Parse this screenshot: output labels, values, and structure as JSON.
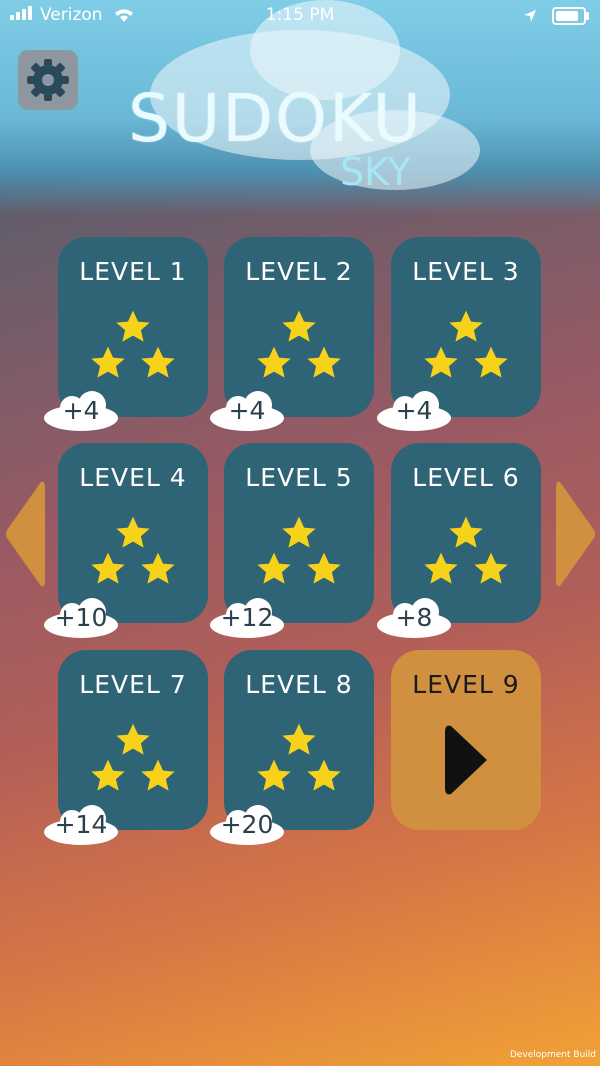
{
  "status_bar": {
    "carrier": "Verizon",
    "time": "1:15 PM"
  },
  "title": {
    "main": "SUDOKU",
    "sub": "SKY"
  },
  "levels": [
    {
      "label": "LEVEL 1",
      "stars": 3,
      "bonus": "+4"
    },
    {
      "label": "LEVEL 2",
      "stars": 3,
      "bonus": "+4"
    },
    {
      "label": "LEVEL 3",
      "stars": 3,
      "bonus": "+4"
    },
    {
      "label": "LEVEL 4",
      "stars": 3,
      "bonus": "+10"
    },
    {
      "label": "LEVEL 5",
      "stars": 3,
      "bonus": "+12"
    },
    {
      "label": "LEVEL 6",
      "stars": 3,
      "bonus": "+8"
    },
    {
      "label": "LEVEL 7",
      "stars": 3,
      "bonus": "+14"
    },
    {
      "label": "LEVEL 8",
      "stars": 3,
      "bonus": "+20"
    },
    {
      "label": "LEVEL 9",
      "current": true
    }
  ],
  "icons": {
    "settings": "gear-icon",
    "prev": "left-arrow-icon",
    "next": "right-arrow-icon",
    "play": "play-icon",
    "star": "star-icon"
  },
  "colors": {
    "tile": "#2f6476",
    "current_tile": "#d0903f",
    "star": "#f6d21b",
    "arrow": "#d0903f"
  },
  "footer": {
    "build": "Development Build"
  }
}
